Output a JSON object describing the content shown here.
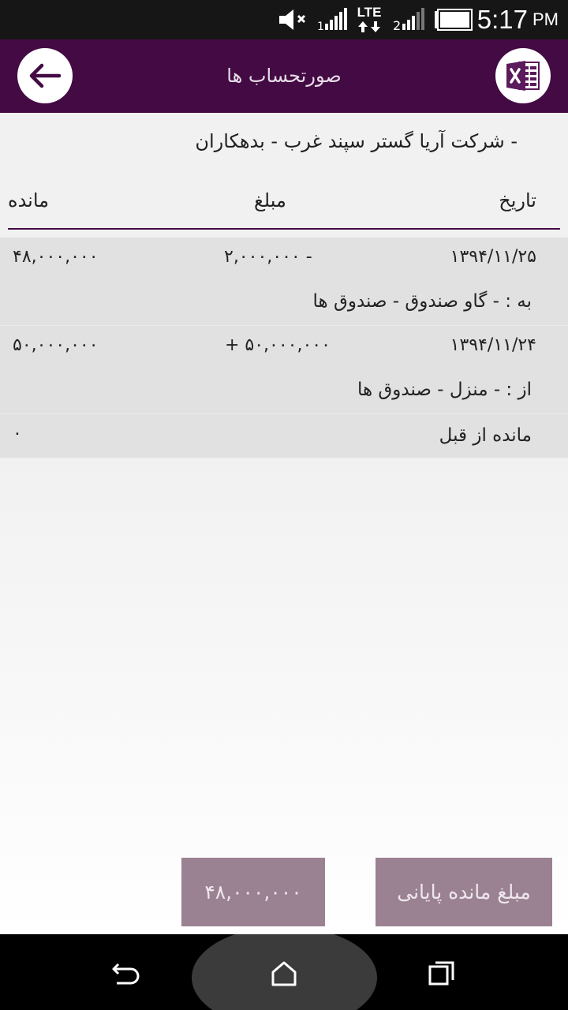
{
  "status_bar": {
    "network_label": "LTE",
    "time": "5:17",
    "ampm": "PM"
  },
  "app_bar": {
    "title": "صورتحساب ها",
    "back_icon": "arrow-left-icon",
    "excel_icon": "excel-export-icon"
  },
  "company_line": "- شرکت آریا گستر سپند غرب  - بدهکاران",
  "table": {
    "headers": {
      "date": "تاریخ",
      "amount": "مبلغ",
      "balance": "مانده"
    },
    "rows": [
      {
        "date": "۱۳۹۴/۱۱/۲۵",
        "amount": "۲,۰۰۰,۰۰۰ -",
        "balance": "۴۸,۰۰۰,۰۰۰",
        "description": "به :  - گاو صندوق - صندوق ها"
      },
      {
        "date": "۱۳۹۴/۱۱/۲۴",
        "amount": "+ ۵۰,۰۰۰,۰۰۰",
        "balance": "۵۰,۰۰۰,۰۰۰",
        "description": "از :  - منزل - صندوق ها"
      }
    ],
    "prior_balance": {
      "label": "مانده از قبل",
      "value": "۰"
    }
  },
  "footer": {
    "final_balance_label": "مبلغ مانده پایانی",
    "final_balance_value": "۴۸,۰۰۰,۰۰۰"
  },
  "colors": {
    "primary": "#430a43",
    "button": "#9a8292",
    "row_bg": "#e1e1e1",
    "page_bg": "#f1f1f1"
  }
}
